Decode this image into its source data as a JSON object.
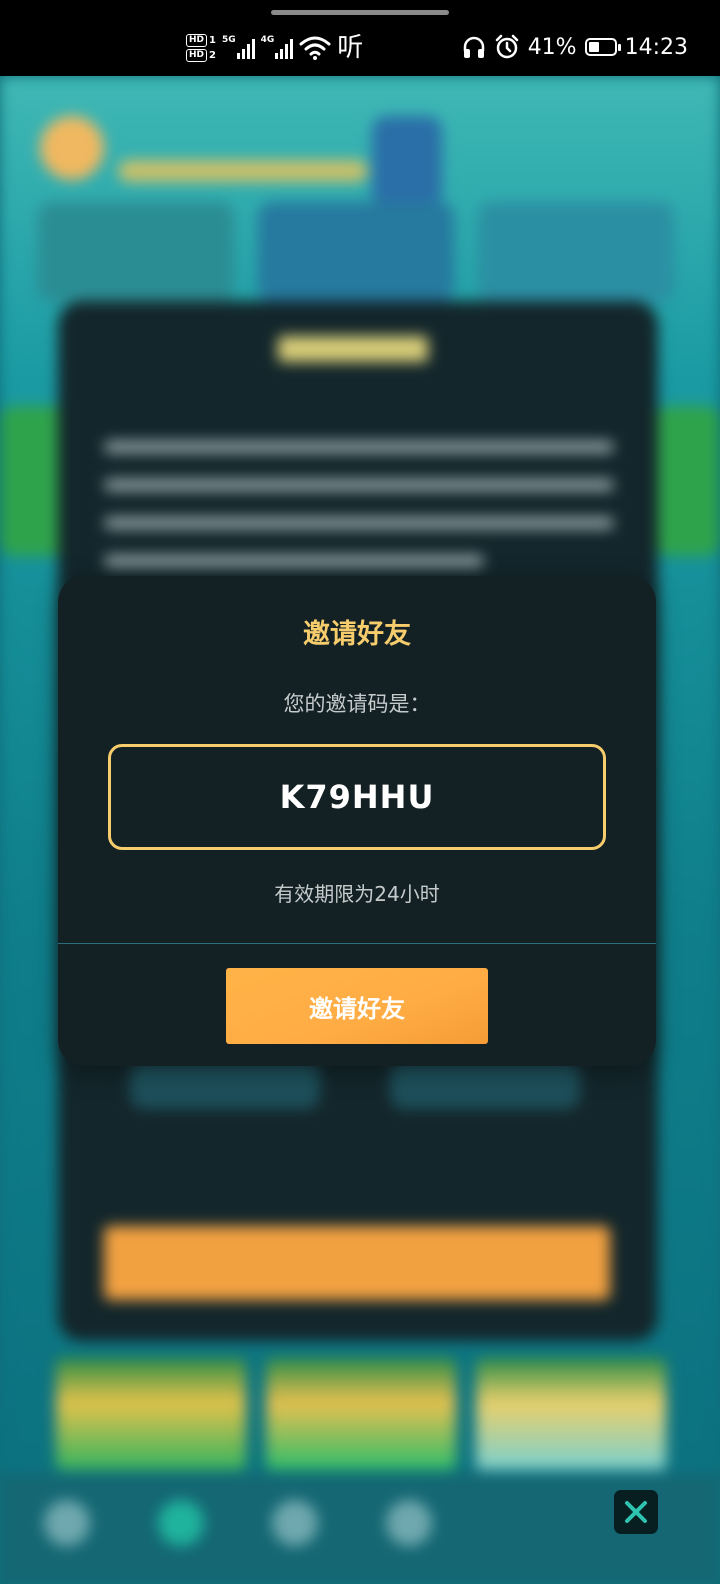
{
  "status_bar": {
    "hd1": "HD",
    "hd1_index": "1",
    "hd2": "HD",
    "hd2_index": "2",
    "net1": "5G",
    "net2": "4G",
    "listen": "听",
    "battery": "41%",
    "time": "14:23",
    "battery_level": 0.41
  },
  "dialog": {
    "title": "邀请好友",
    "label": "您的邀请码是：",
    "invite_code": "K79HHU",
    "expiry": "有效期限为24小时",
    "button": "邀请好友"
  },
  "colors": {
    "accent_gold": "#f6cc6c",
    "button_orange": "#ffac44",
    "dialog_bg": "#132124",
    "close_icon": "#2ec4b0"
  },
  "icons": [
    "headphones-icon",
    "alarm-icon",
    "wifi-icon",
    "signal-icon",
    "battery-icon",
    "close-icon"
  ]
}
